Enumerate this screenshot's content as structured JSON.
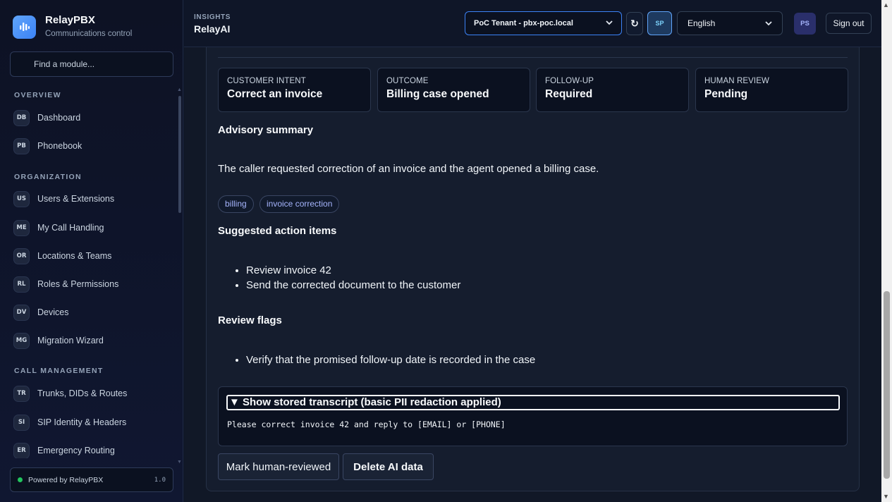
{
  "brand": {
    "name": "RelayPBX",
    "subtitle": "Communications control"
  },
  "module_search": {
    "placeholder": "Find a module..."
  },
  "nav": {
    "sections": [
      {
        "label": "OVERVIEW",
        "items": [
          {
            "code": "DB",
            "label": "Dashboard"
          },
          {
            "code": "PB",
            "label": "Phonebook"
          }
        ]
      },
      {
        "label": "ORGANIZATION",
        "items": [
          {
            "code": "US",
            "label": "Users & Extensions"
          },
          {
            "code": "ME",
            "label": "My Call Handling"
          },
          {
            "code": "OR",
            "label": "Locations & Teams"
          },
          {
            "code": "RL",
            "label": "Roles & Permissions"
          },
          {
            "code": "DV",
            "label": "Devices"
          },
          {
            "code": "MG",
            "label": "Migration Wizard"
          }
        ]
      },
      {
        "label": "CALL MANAGEMENT",
        "items": [
          {
            "code": "TR",
            "label": "Trunks, DIDs & Routes"
          },
          {
            "code": "SI",
            "label": "SIP Identity & Headers"
          },
          {
            "code": "ER",
            "label": "Emergency Routing"
          }
        ]
      }
    ]
  },
  "footer": {
    "powered_by": "Powered by RelayPBX",
    "version": "1.0",
    "status_color": "#22c55e"
  },
  "topbar": {
    "eyebrow": "INSIGHTS",
    "title": "RelayAI",
    "tenant": "PoC Tenant - pbx-poc.local",
    "sp_label": "SP",
    "language": "English",
    "avatar_initials": "PS",
    "signout": "Sign out"
  },
  "stats": [
    {
      "label": "CUSTOMER INTENT",
      "value": "Correct an invoice"
    },
    {
      "label": "OUTCOME",
      "value": "Billing case opened"
    },
    {
      "label": "FOLLOW-UP",
      "value": "Required"
    },
    {
      "label": "HUMAN REVIEW",
      "value": "Pending"
    }
  ],
  "advisory": {
    "heading": "Advisory summary",
    "text": "The caller requested correction of an invoice and the agent opened a billing case.",
    "tags": [
      "billing",
      "invoice correction"
    ]
  },
  "actions": {
    "heading": "Suggested action items",
    "items": [
      "Review invoice 42",
      "Send the corrected document to the customer"
    ]
  },
  "flags": {
    "heading": "Review flags",
    "items": [
      "Verify that the promised follow-up date is recorded in the case"
    ]
  },
  "transcript": {
    "summary": "▼ Show stored transcript (basic PII redaction applied)",
    "text": "Please correct invoice 42 and reply to [EMAIL] or [PHONE]"
  },
  "buttons": {
    "mark_reviewed": "Mark human-reviewed",
    "delete_ai": "Delete AI data"
  },
  "colors": {
    "accent": "#3b82f6",
    "tag_text": "#a5b4fc",
    "panel_bg": "#151d2e"
  }
}
